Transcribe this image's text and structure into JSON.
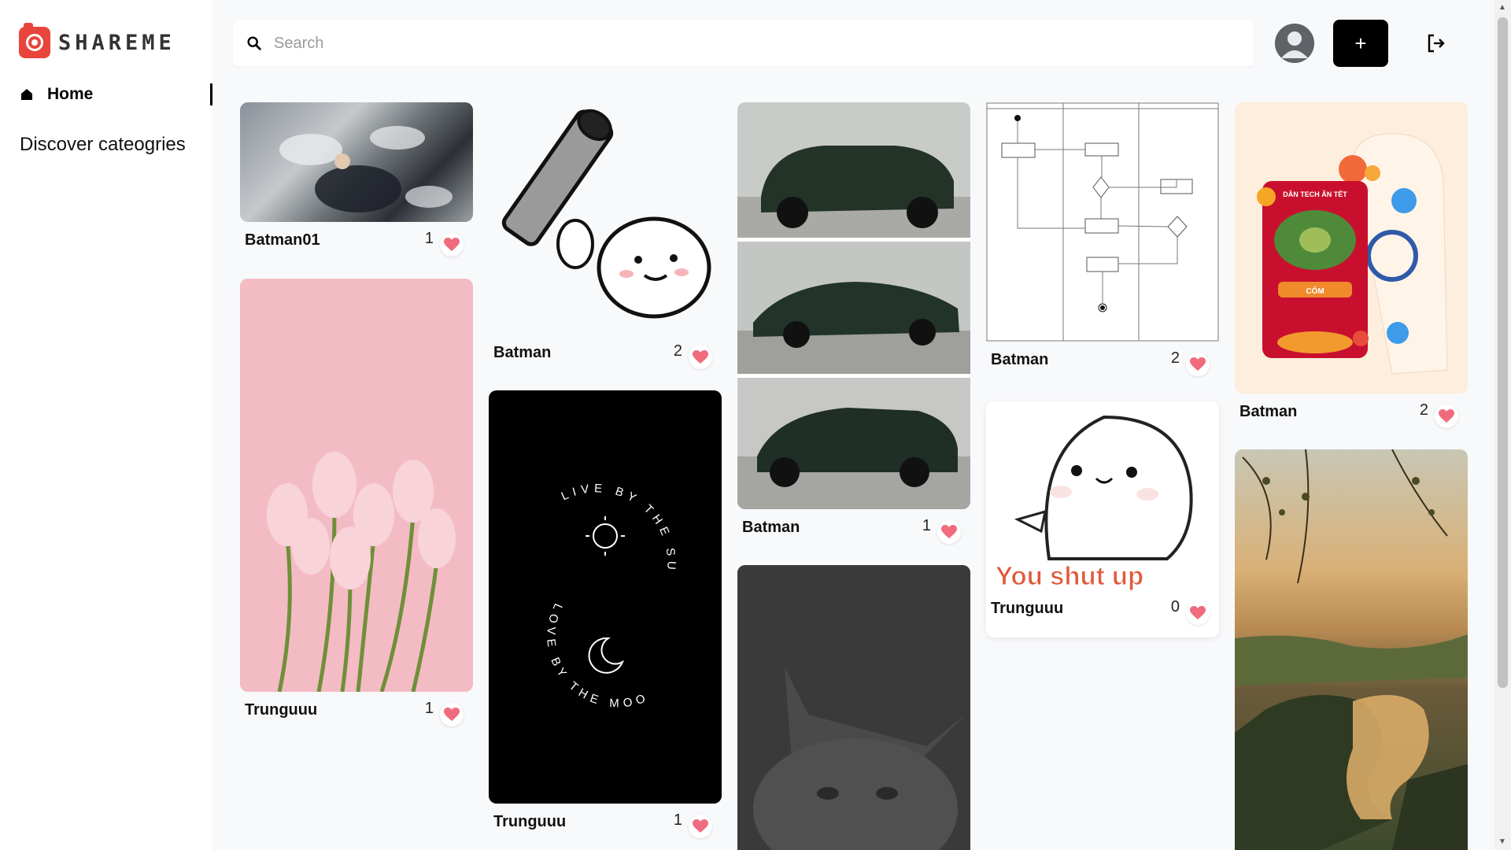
{
  "app": {
    "name": "SHAREME"
  },
  "sidebar": {
    "home_label": "Home",
    "discover_label": "Discover cateogries"
  },
  "header": {
    "search_placeholder": "Search",
    "add_label": "+"
  },
  "colors": {
    "brand": "#e8453c",
    "heart": "#f06b7e",
    "button": "#000000"
  },
  "pins": [
    {
      "name": "Batman01",
      "likes": "1",
      "image": "angel-wings-photo"
    },
    {
      "name": "Trunguuu",
      "likes": "1",
      "image": "pink-tulips-photo"
    },
    {
      "name": "Batman",
      "likes": "2",
      "image": "cartoon-gun-sticker"
    },
    {
      "name": "Trunguuu",
      "likes": "1",
      "image": "live-by-the-sun-poster"
    },
    {
      "name": "Batman",
      "likes": "1",
      "image": "green-mustang-cars"
    },
    {
      "name": "",
      "likes": "",
      "image": "grey-cat-photo"
    },
    {
      "name": "Batman",
      "likes": "2",
      "image": "activity-diagram"
    },
    {
      "name": "Trunguuu",
      "likes": "0",
      "image": "you-shut-up-sticker"
    },
    {
      "name": "Batman",
      "likes": "2",
      "image": "tet-envelope"
    },
    {
      "name": "",
      "likes": "",
      "image": "sunset-river-photo"
    }
  ],
  "texts": {
    "poster_sun": "LIVE BY THE SUN.",
    "poster_moon": "LOVE BY THE MOON.",
    "sticker_text": "You shut up",
    "envelope_title": "DÂN TECH ĂN TẾT",
    "envelope_label": "CỐM"
  }
}
